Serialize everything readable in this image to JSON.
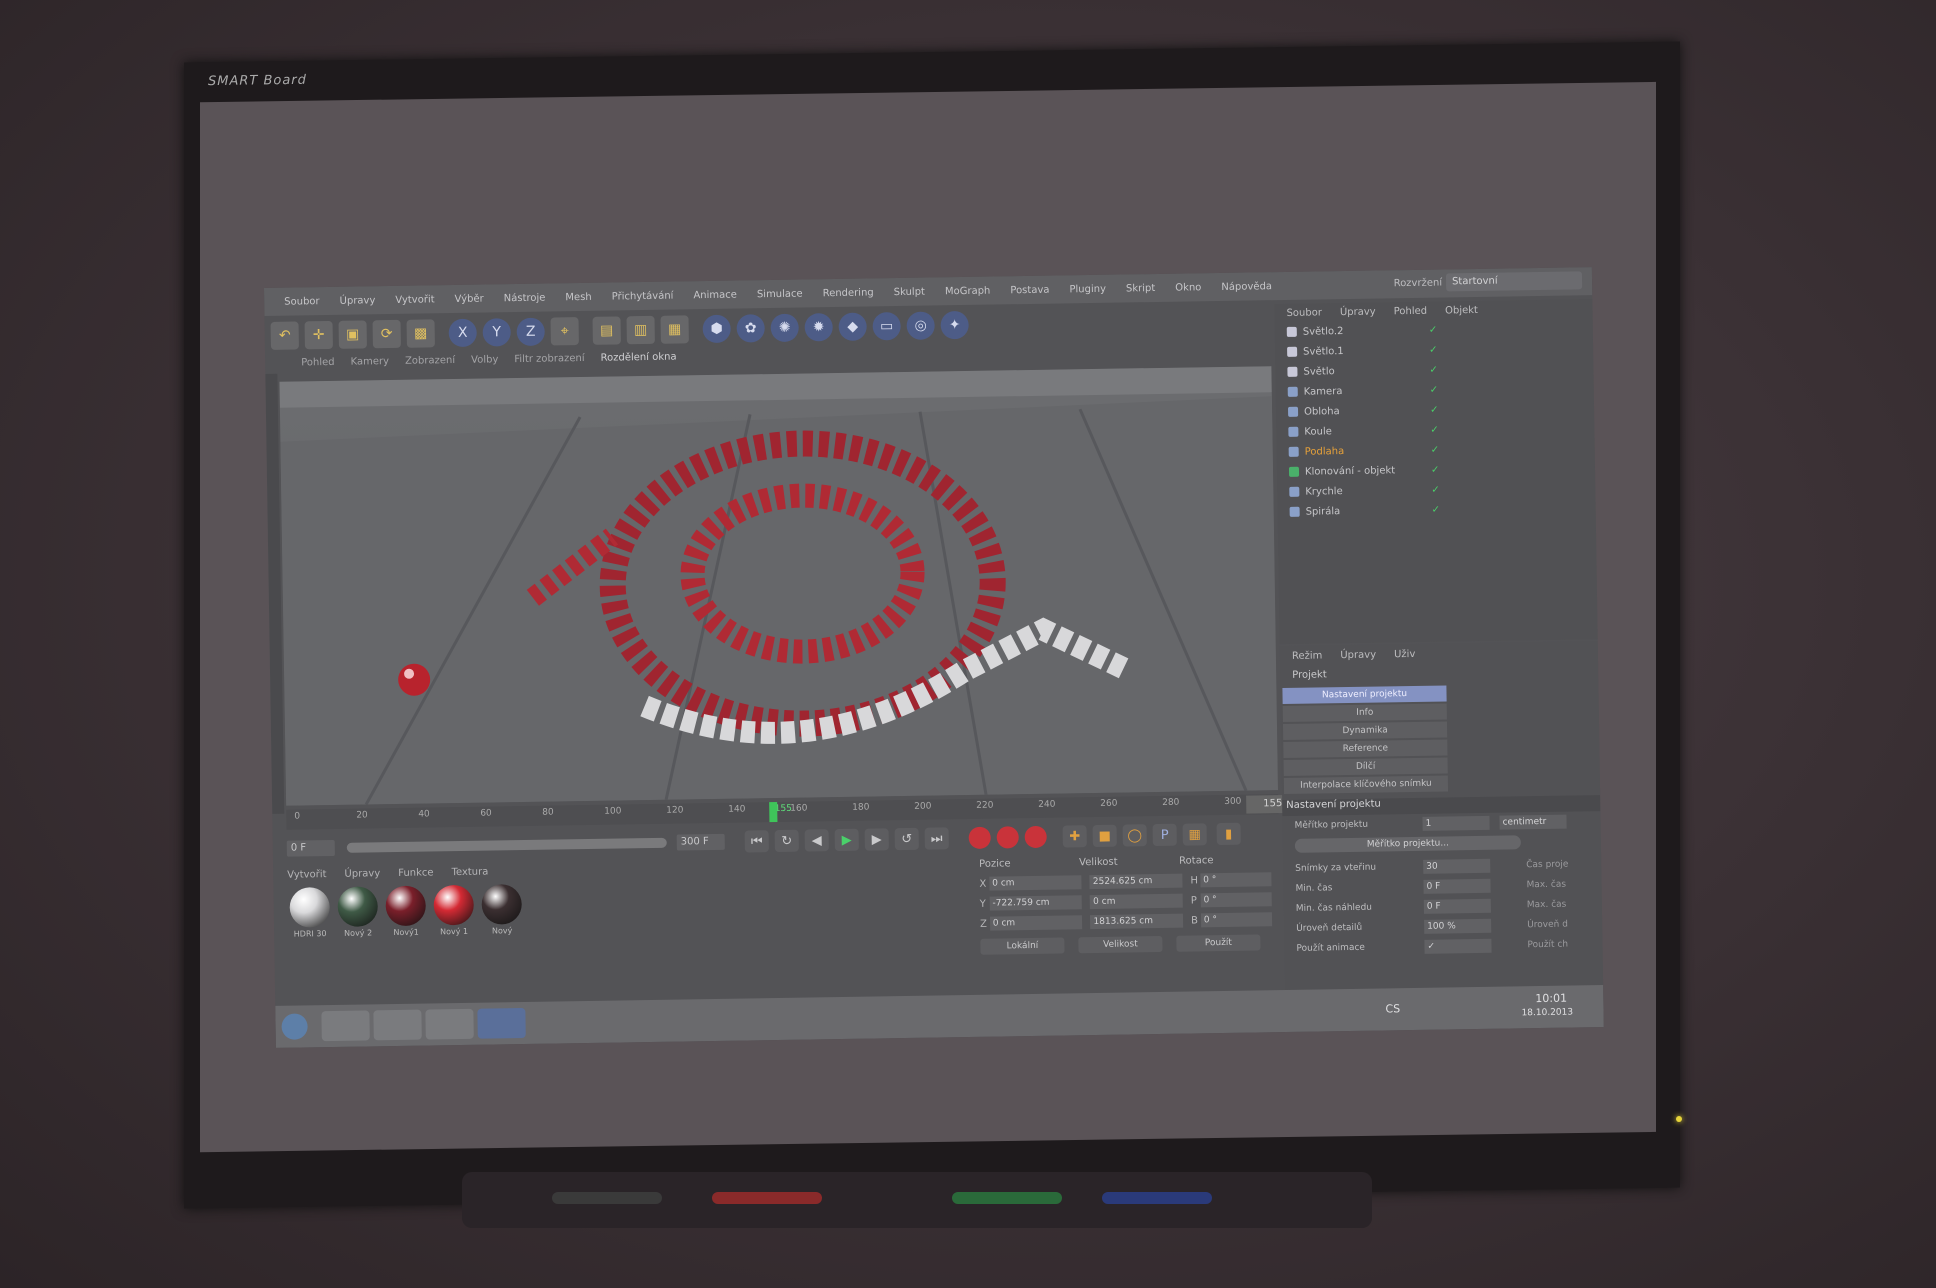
{
  "whiteboard": {
    "brand": "SMART Board"
  },
  "app": {
    "menu": [
      "Soubor",
      "Úpravy",
      "Vytvořit",
      "Výběr",
      "Nástroje",
      "Mesh",
      "Přichytávání",
      "Animace",
      "Simulace",
      "Rendering",
      "Skulpt",
      "MoGraph",
      "Postava",
      "Pluginy",
      "Skript",
      "Okno",
      "Nápověda"
    ],
    "layout_label": "Rozvržení",
    "layout_value": "Startovní",
    "toolbar_icons": [
      "undo-icon",
      "move-icon",
      "scale-icon",
      "rotate-icon",
      "select-icon",
      "x-axis-icon",
      "y-axis-icon",
      "z-axis-icon",
      "coord-icon",
      "render-region-icon",
      "render-view-icon",
      "render-settings-icon",
      "cube-icon",
      "spline-icon",
      "nurbs-icon",
      "array-icon",
      "deformer-icon",
      "floor-icon",
      "camera-icon",
      "light-icon"
    ],
    "viewport_tabs": [
      "Pohled",
      "Kamery",
      "Zobrazení",
      "Volby",
      "Filtr zobrazení",
      "Rozdělení okna"
    ],
    "viewport_active_tab": "Rozdělení okna",
    "timeline": {
      "ticks": [
        "0",
        "20",
        "40",
        "60",
        "80",
        "100",
        "120",
        "140",
        "155",
        "160",
        "180",
        "200",
        "220",
        "240",
        "260",
        "280",
        "300"
      ],
      "current": "155",
      "frame_box": "155 F"
    },
    "playback": {
      "start": "0 F",
      "end": "300 F"
    },
    "materials": {
      "menu": [
        "Vytvořit",
        "Úpravy",
        "Funkce",
        "Textura"
      ],
      "items": [
        {
          "name": "HDRI 30",
          "color": "#d9d9db"
        },
        {
          "name": "Nový 2",
          "color": "#3f5a46"
        },
        {
          "name": "Nový1",
          "color": "#7a1f2a"
        },
        {
          "name": "Nový 1",
          "color": "#d42a34"
        },
        {
          "name": "Nový",
          "color": "#3b2f31"
        }
      ]
    },
    "coordinates": {
      "headers": [
        "Pozice",
        "Velikost",
        "Rotace"
      ],
      "rows": [
        {
          "axis": "X",
          "pos": "0 cm",
          "size": "2524.625 cm",
          "rlabel": "H",
          "rot": "0 °"
        },
        {
          "axis": "Y",
          "pos": "-722.759 cm",
          "size": "0 cm",
          "rlabel": "P",
          "rot": "0 °"
        },
        {
          "axis": "Z",
          "pos": "0 cm",
          "size": "1813.625 cm",
          "rlabel": "B",
          "rot": "0 °"
        }
      ],
      "mode1": "Lokální",
      "mode2": "Velikost",
      "apply": "Použít"
    },
    "object_manager": {
      "menu": [
        "Soubor",
        "Úpravy",
        "Pohled",
        "Objekt"
      ],
      "objects": [
        {
          "name": "Světlo.2",
          "icon_color": "#c8c8d8",
          "selected": false
        },
        {
          "name": "Světlo.1",
          "icon_color": "#c8c8d8",
          "selected": false
        },
        {
          "name": "Světlo",
          "icon_color": "#c8c8d8",
          "selected": false
        },
        {
          "name": "Kamera",
          "icon_color": "#8aa0c8",
          "selected": false
        },
        {
          "name": "Obloha",
          "icon_color": "#8aa0c8",
          "selected": false
        },
        {
          "name": "Koule",
          "icon_color": "#8aa0c8",
          "selected": false
        },
        {
          "name": "Podlaha",
          "icon_color": "#8aa0c8",
          "selected": true
        },
        {
          "name": "Klonování - objekt",
          "icon_color": "#4ab06a",
          "selected": false
        },
        {
          "name": "Krychle",
          "icon_color": "#8aa0c8",
          "selected": false
        },
        {
          "name": "Spirála",
          "icon_color": "#8aa0c8",
          "selected": false
        }
      ]
    },
    "attributes": {
      "menu": [
        "Režim",
        "Úpravy",
        "Uživ"
      ],
      "title": "Projekt",
      "tabs": [
        "Nastavení projektu",
        "Info",
        "Dynamika",
        "Reference",
        "Dílčí",
        "Interpolace klíčového snímku"
      ],
      "selected_tab": "Nastavení projektu",
      "section": "Nastavení projektu",
      "scale_label": "Měřítko projektu",
      "scale_value": "1",
      "scale_unit": "centimetr",
      "scale_button": "Měřítko projektu...",
      "rows": [
        {
          "label": "Snímky za vteřinu",
          "value": "30",
          "right": "Čas proje"
        },
        {
          "label": "Min. čas",
          "value": "0 F",
          "right": "Max. čas"
        },
        {
          "label": "Min. čas náhledu",
          "value": "0 F",
          "right": "Max. čas"
        },
        {
          "label": "Úroveň detailů",
          "value": "100 %",
          "right": "Úroveň d"
        },
        {
          "label": "Použít animace",
          "value": "✓",
          "right": "Použít ch"
        }
      ]
    },
    "taskbar": {
      "lang": "CS",
      "time": "10:01",
      "date": "18.10.2013"
    }
  }
}
